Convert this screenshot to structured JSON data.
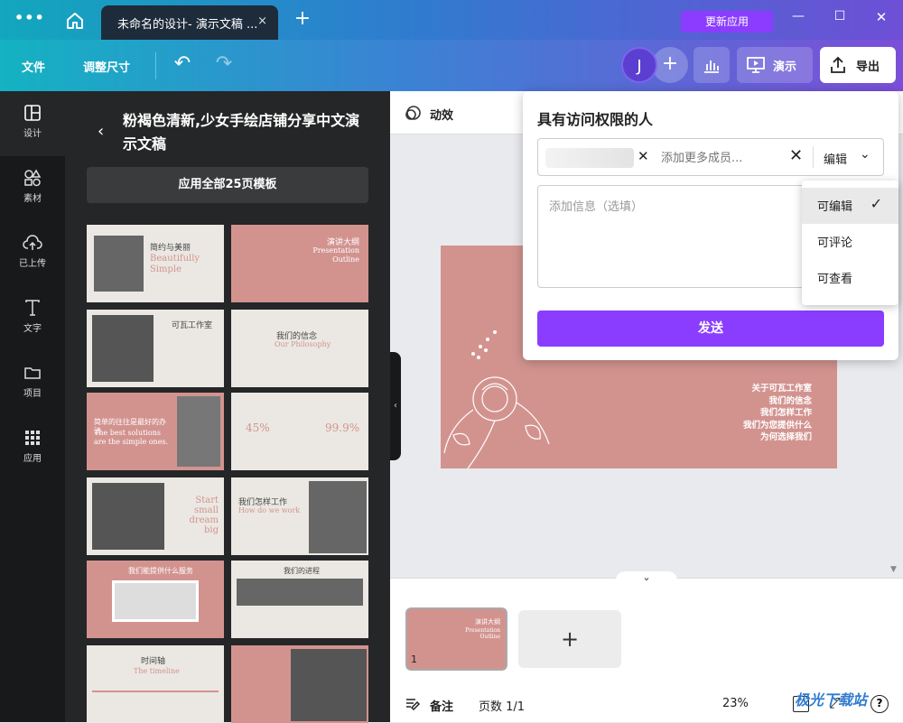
{
  "titlebar": {
    "menu_icon": "more-dots-icon",
    "home_icon": "home-icon",
    "tab_title": "未命名的设计- 演示文稿 ...",
    "tab_close": "×",
    "new_tab": "+",
    "update_button": "更新应用",
    "minimize": "—",
    "maximize": "☐",
    "close": "✕"
  },
  "toolbar": {
    "file": "文件",
    "resize": "调整尺寸",
    "undo": "↶",
    "redo": "↷",
    "avatar_letter": "J",
    "add_person": "+",
    "insights_icon": "bar-chart-icon",
    "present": "演示",
    "export": "导出"
  },
  "rail": {
    "items": [
      {
        "label": "设计",
        "icon": "layout-icon"
      },
      {
        "label": "素材",
        "icon": "shapes-icon"
      },
      {
        "label": "已上传",
        "icon": "cloud-upload-icon"
      },
      {
        "label": "文字",
        "icon": "text-icon"
      },
      {
        "label": "项目",
        "icon": "folder-icon"
      },
      {
        "label": "应用",
        "icon": "apps-grid-icon"
      }
    ]
  },
  "panel": {
    "title": "粉褐色清新,少女手绘店铺分享中文演示文稿",
    "apply_all": "应用全部25页模板"
  },
  "templates": {
    "t1": {
      "title": "简约与美丽",
      "sub": "Beautifully Simple"
    },
    "t2": {
      "title": "演讲大纲",
      "sub": "Presentation Outline"
    },
    "t3": {
      "title": "可瓦工作室"
    },
    "t4": {
      "title": "我们的信念",
      "sub": "Our Philosophy"
    },
    "t5": {
      "title": "简单的往往是最好的办法",
      "sub": "The best solutions are the simple ones."
    },
    "t6": {
      "left": "45%",
      "right": "99.9%"
    },
    "t7": {
      "title": "Start small dream big"
    },
    "t8": {
      "title": "我们怎样工作",
      "sub": "How do we work"
    },
    "t9": {
      "title": "我们能提供什么服务"
    },
    "t10": {
      "title": "我们的进程"
    },
    "t11": {
      "title": "时间轴",
      "sub": "The timeline"
    },
    "t12": {
      "title": ""
    }
  },
  "canvas": {
    "animate_label": "动效",
    "slide_lines": [
      "关于可瓦工作室",
      "我们的信念",
      "我们怎样工作",
      "我们为您提供什么",
      "为何选择我们"
    ],
    "page_thumb_title": "演讲大纲",
    "page_thumb_sub": "Presentation Outline",
    "page_number": "1",
    "add_page": "+"
  },
  "statusbar": {
    "notes": "备注",
    "pages": "页数 1/1",
    "zoom": "23%",
    "help": "?"
  },
  "share": {
    "title": "具有访问权限的人",
    "add_members_placeholder": "添加更多成员...",
    "permission_dropdown": "编辑",
    "message_placeholder": "添加信息（选填）",
    "send": "发送",
    "options": [
      "可编辑",
      "可评论",
      "可查看"
    ],
    "selected_check": "✓"
  },
  "watermark": "极光下载站"
}
